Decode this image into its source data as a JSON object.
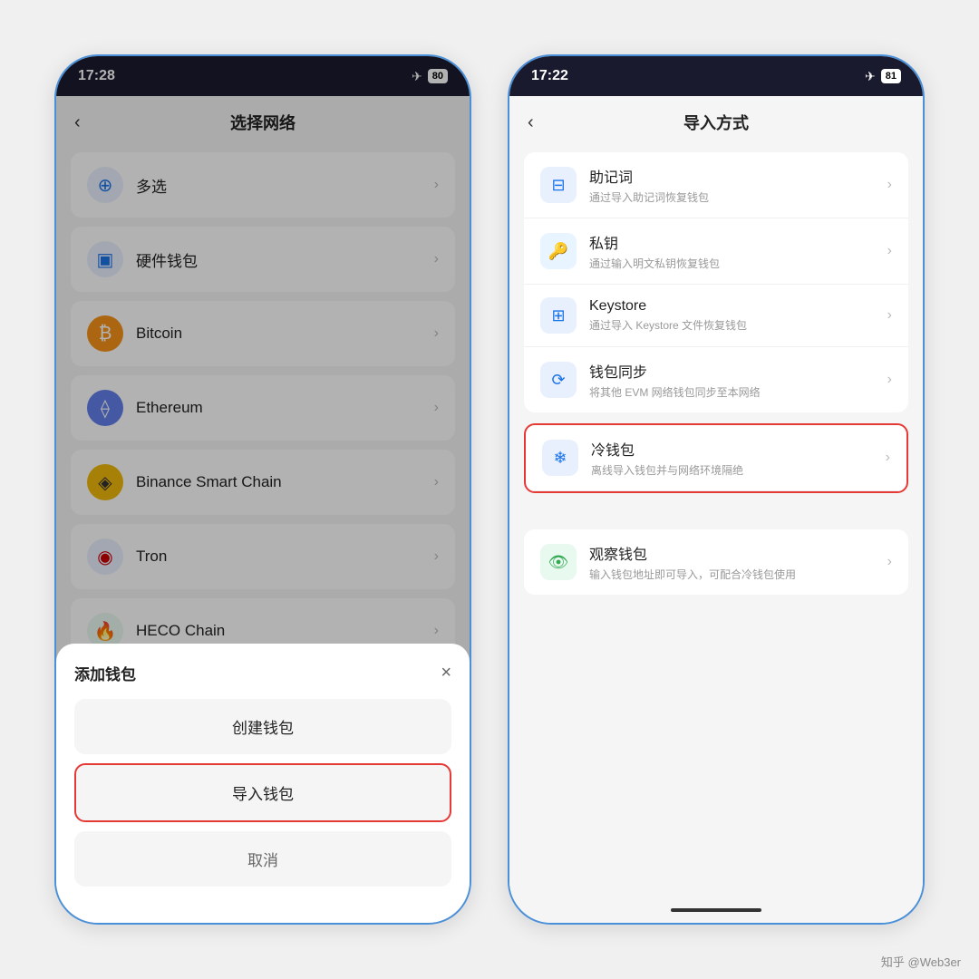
{
  "left_phone": {
    "status_time": "17:28",
    "battery": "80",
    "page_title": "选择网络",
    "back_label": "‹",
    "networks": [
      {
        "name": "多选",
        "icon_type": "multiselect"
      },
      {
        "name": "硬件钱包",
        "icon_type": "hardware"
      },
      {
        "name": "Bitcoin",
        "icon_type": "bitcoin"
      },
      {
        "name": "Ethereum",
        "icon_type": "ethereum"
      },
      {
        "name": "Binance Smart Chain",
        "icon_type": "binance"
      },
      {
        "name": "Tron",
        "icon_type": "tron"
      },
      {
        "name": "HECO Chain",
        "icon_type": "heco"
      }
    ],
    "sheet_title": "添加钱包",
    "sheet_close": "×",
    "sheet_buttons": [
      {
        "label": "创建钱包",
        "highlighted": false,
        "cancel": false
      },
      {
        "label": "导入钱包",
        "highlighted": true,
        "cancel": false
      },
      {
        "label": "取消",
        "highlighted": false,
        "cancel": true
      }
    ]
  },
  "right_phone": {
    "status_time": "17:22",
    "battery": "81",
    "page_title": "导入方式",
    "back_label": "‹",
    "sections": [
      {
        "items": [
          {
            "title": "助记词",
            "desc": "通过导入助记词恢复钱包",
            "icon_type": "mnemonic"
          },
          {
            "title": "私钥",
            "desc": "通过输入明文私钥恢复钱包",
            "icon_type": "privatekey"
          },
          {
            "title": "Keystore",
            "desc": "通过导入 Keystore 文件恢复钱包",
            "icon_type": "keystore"
          },
          {
            "title": "钱包同步",
            "desc": "将其他 EVM 网络钱包同步至本网络",
            "icon_type": "walletsync"
          }
        ]
      },
      {
        "items": [
          {
            "title": "冷钱包",
            "desc": "离线导入钱包并与网络环境隔绝",
            "icon_type": "coldwallet",
            "highlighted": true
          }
        ]
      },
      {
        "items": [
          {
            "title": "观察钱包",
            "desc": "输入钱包地址即可导入，可配合冷钱包使用",
            "icon_type": "watchonly"
          }
        ]
      }
    ]
  },
  "watermark": "知乎 @Web3er"
}
